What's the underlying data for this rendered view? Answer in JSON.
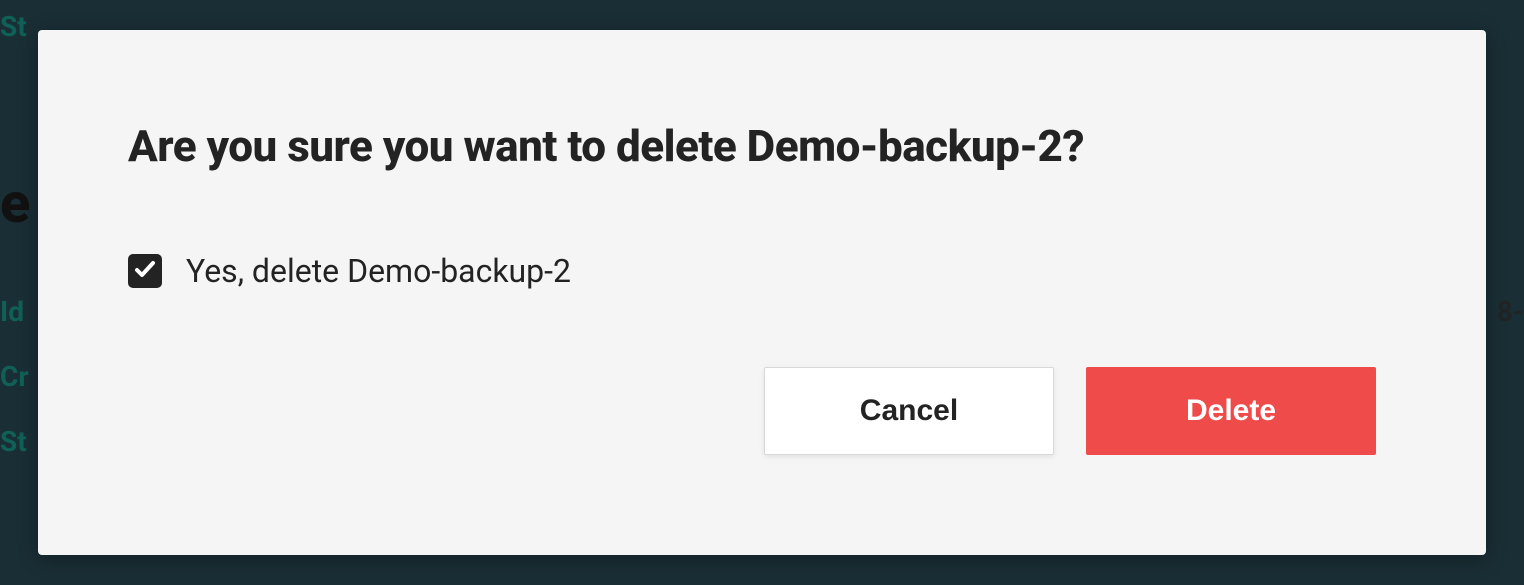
{
  "background": {
    "st1": "St",
    "id": "Id",
    "cr": "Cr",
    "st2": "St",
    "right": "8-",
    "headingFragment": "e"
  },
  "modal": {
    "title": "Are you sure you want to delete Demo-backup-2?",
    "checkbox": {
      "checked": true,
      "label": "Yes, delete Demo-backup-2"
    },
    "buttons": {
      "cancel": "Cancel",
      "delete": "Delete"
    }
  }
}
